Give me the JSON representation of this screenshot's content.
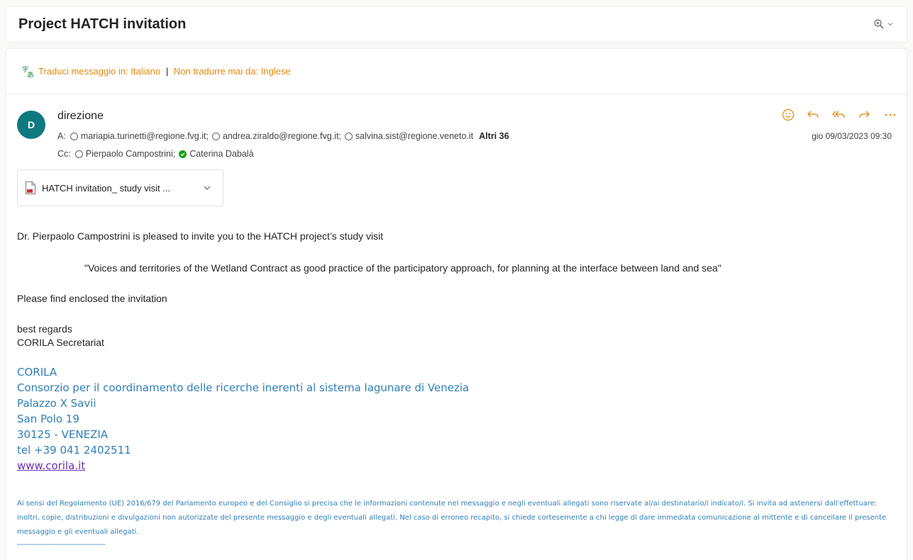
{
  "subject": "Project HATCH invitation",
  "translate": {
    "link1": "Traduci messaggio in: Italiano",
    "separator": "|",
    "link2": "Non tradurre mai da: Inglese"
  },
  "sender": {
    "initial": "D",
    "name": "direzione",
    "avatar_color": "#0e7a7f"
  },
  "to": {
    "label": "A:",
    "recipients": [
      "mariapia.turinetti@regione.fvg.it;",
      "andrea.ziraldo@regione.fvg.it;",
      "salvina.sist@regione.veneto.it"
    ],
    "more": "Altri 36"
  },
  "cc": {
    "label": "Cc:",
    "recipients": [
      "Pierpaolo Campostrini;",
      "Caterina Dabalà"
    ]
  },
  "date": "gio 09/03/2023 09:30",
  "attachment": {
    "name": "HATCH invitation_ study visit ..."
  },
  "body": {
    "intro": "Dr. Pierpaolo Campostrini is pleased to invite you to the HATCH project’s study visit",
    "quote": "\"Voices and territories of the Wetland Contract as good practice of the participatory approach, for planning at the interface between land and sea\"",
    "enclosed": "Please find enclosed the invitation",
    "regards": "best regards",
    "secretariat": "CORILA Secretariat"
  },
  "signature": {
    "line1": "CORILA",
    "line2": "Consorzio per il coordinamento delle ricerche inerenti al sistema lagunare di Venezia",
    "line3": "Palazzo X Savii",
    "line4": "San Polo 19",
    "line5": "30125 - VENEZIA",
    "line6": "tel +39 041 2402511",
    "website": "www.corila.it"
  },
  "disclaimer": "Ai sensi del Regolamento (UE) 2016/679 del Parlamento europeo e del Consiglio si precisa che le informazioni contenute nel messaggio e negli eventuali allegati sono riservate al/ai destinatario/i indicato/i. Si invita ad astenersi dall'effettuare: inoltri, copie, distribuzioni e divulgazioni non autorizzate del presente messaggio e degli eventuali allegati. Nel caso di erroneo recapito, si chiede cortesemente a chi legge di dare immediata comunicazione al mittente e di cancellare il presente messaggio e gli eventuali allegati.",
  "dashes": "--------------------------------------------",
  "colors": {
    "accent_orange": "#e3880c",
    "signature_blue": "#2f7fb6",
    "link_purple": "#6a2fb4",
    "check_green": "#13a10e"
  },
  "icons": [
    "zoom-icon",
    "chevron-down-icon",
    "translate-icon",
    "emoji-icon",
    "reply-icon",
    "reply-all-icon",
    "forward-icon",
    "more-icon",
    "pdf-icon",
    "check-icon"
  ]
}
